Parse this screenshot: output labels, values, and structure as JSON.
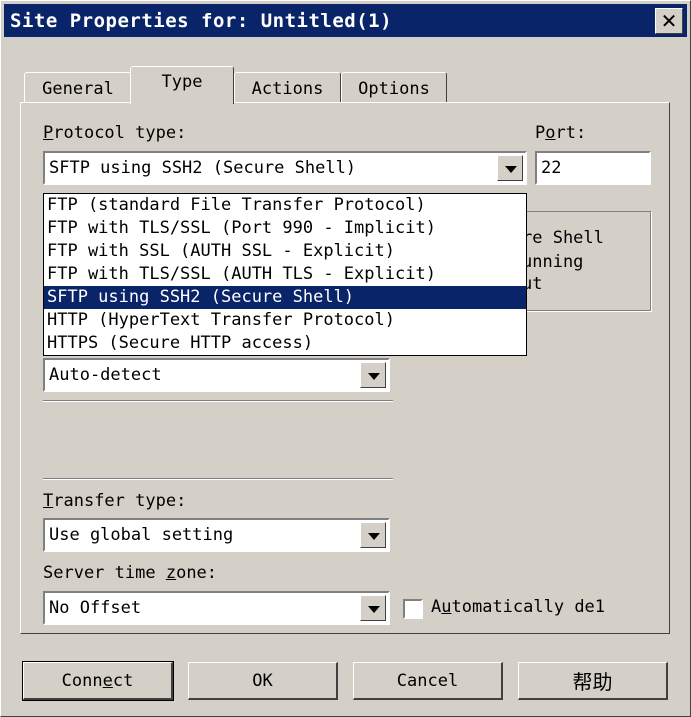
{
  "window": {
    "title": "Site Properties for: Untitled(1)",
    "close_label": "✕"
  },
  "tabs": [
    {
      "label": "General"
    },
    {
      "label": "Type",
      "active": true
    },
    {
      "label": "Actions"
    },
    {
      "label": "Options"
    }
  ],
  "protocol": {
    "label_first": "P",
    "label_rest": "rotocol type:",
    "value": "SFTP using SSH2 (Secure Shell)",
    "options": [
      "FTP (standard File Transfer Protocol)",
      "FTP with TLS/SSL (Port 990 - Implicit)",
      "FTP with SSL (AUTH SSL - Explicit)",
      "FTP with TLS/SSL (AUTH TLS - Explicit)",
      "SFTP using SSH2 (Secure Shell)",
      "HTTP (HyperText Transfer Protocol)",
      "HTTPS (Secure HTTP access)"
    ],
    "selected_index": 4
  },
  "port": {
    "label_first": "P",
    "label_u": "o",
    "label_rest": "rt:",
    "value": "22"
  },
  "info_text": {
    "line1": "re Shell",
    "line2": "unning",
    "line3": "ut"
  },
  "server_type": {
    "value": "Auto-detect"
  },
  "transfer_type": {
    "label_u": "T",
    "label_rest": "ransfer type:",
    "value": "Use global setting"
  },
  "time_zone": {
    "label_pre": "Server time ",
    "label_u": "z",
    "label_rest": "one:",
    "value": "No Offset"
  },
  "auto_detect_checkbox": {
    "label_pre": "A",
    "label_u": "u",
    "label_rest": "tomatically de1",
    "checked": false
  },
  "buttons": {
    "connect_pre": "Conn",
    "connect_u": "e",
    "connect_rest": "ct",
    "ok": "OK",
    "cancel": "Cancel",
    "help": "帮助"
  }
}
